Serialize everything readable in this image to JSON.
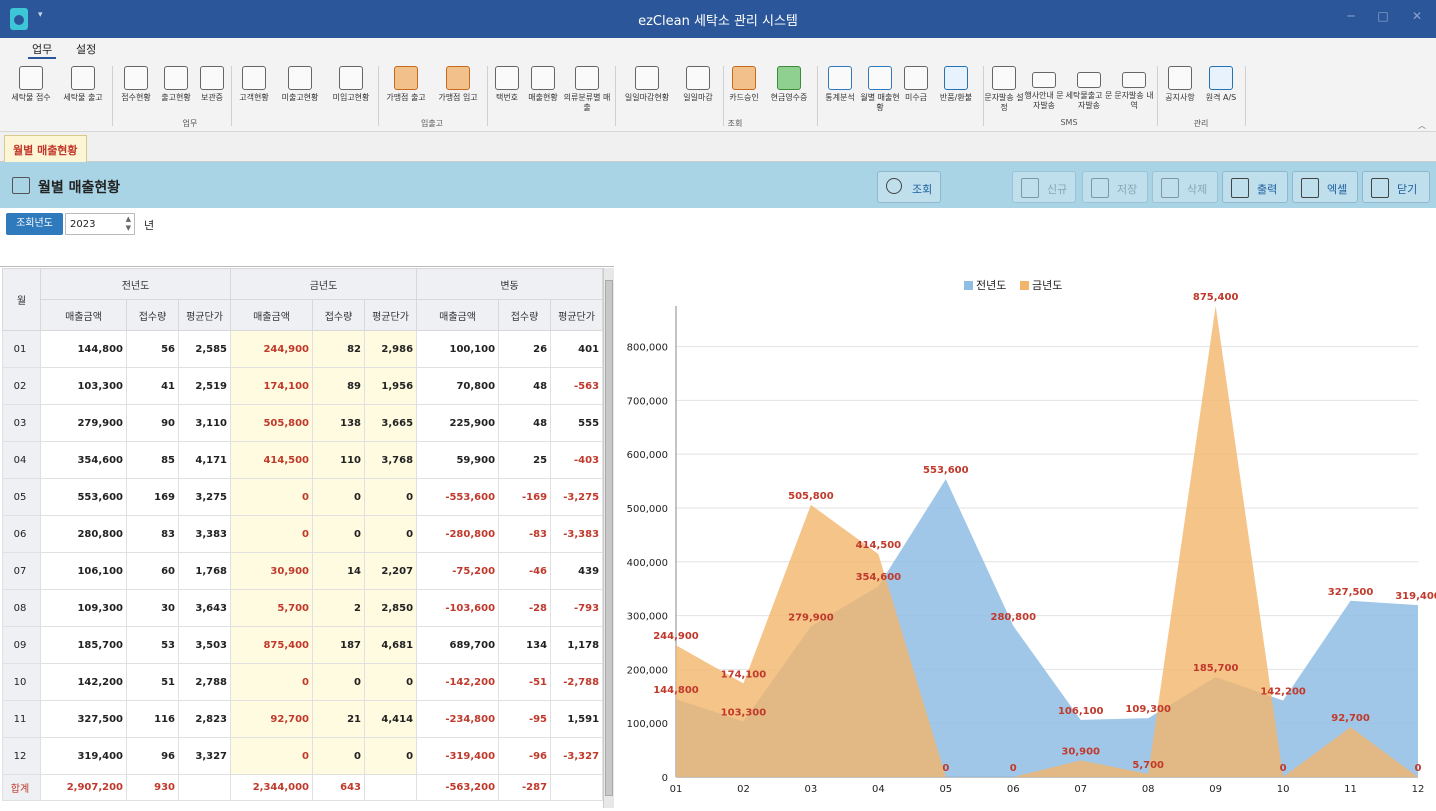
{
  "app": {
    "title": "ezClean 세탁소 관리 시스템",
    "quick_access": "▾"
  },
  "menu": {
    "tabs": [
      {
        "label": "업무",
        "active": true
      },
      {
        "label": "설정",
        "active": false
      }
    ]
  },
  "ribbon": {
    "groups": [
      {
        "label": "업무",
        "items": [
          "세탁물 접수",
          "세탁물 출고",
          "접수현황",
          "출고현황",
          "보관증",
          "고객현황",
          "미출고현황",
          "미입고현황"
        ]
      },
      {
        "label": "입출고",
        "items": [
          "가맹점 출고",
          "가맹점 입고"
        ]
      },
      {
        "label": "조회",
        "items": [
          "택번호",
          "매출현황",
          "의류분류별 매출",
          "일일마감현황",
          "일일마감",
          "카드승인",
          "현금영수증",
          "통계분석",
          "월별 매출현황",
          "미수금",
          "반품/환불"
        ]
      },
      {
        "label": "SMS",
        "items": [
          "문자발송 설정",
          "행사안내 문자발송",
          "세탁물출고 문자발송",
          "문자발송 내역"
        ]
      },
      {
        "label": "관리",
        "items": [
          "공지사항",
          "원격 A/S"
        ]
      }
    ]
  },
  "tab": {
    "label": "월별 매출현황"
  },
  "header": {
    "title": "월별 매출현황",
    "buttons": {
      "search": "조회",
      "new": "신규",
      "save": "저장",
      "delete": "삭제",
      "print": "출력",
      "excel": "엑셀",
      "close": "닫기"
    }
  },
  "filter": {
    "label": "조회년도",
    "value": "2023",
    "unit": "년"
  },
  "table": {
    "month_header": "월",
    "groups": [
      "전년도",
      "금년도",
      "변동"
    ],
    "subheaders": [
      "매출금액",
      "접수량",
      "평균단가"
    ],
    "rows": [
      [
        "01",
        "144,800",
        "56",
        "2,585",
        "244,900",
        "82",
        "2,986",
        "100,100",
        "26",
        "401"
      ],
      [
        "02",
        "103,300",
        "41",
        "2,519",
        "174,100",
        "89",
        "1,956",
        "70,800",
        "48",
        "-563"
      ],
      [
        "03",
        "279,900",
        "90",
        "3,110",
        "505,800",
        "138",
        "3,665",
        "225,900",
        "48",
        "555"
      ],
      [
        "04",
        "354,600",
        "85",
        "4,171",
        "414,500",
        "110",
        "3,768",
        "59,900",
        "25",
        "-403"
      ],
      [
        "05",
        "553,600",
        "169",
        "3,275",
        "0",
        "0",
        "0",
        "-553,600",
        "-169",
        "-3,275"
      ],
      [
        "06",
        "280,800",
        "83",
        "3,383",
        "0",
        "0",
        "0",
        "-280,800",
        "-83",
        "-3,383"
      ],
      [
        "07",
        "106,100",
        "60",
        "1,768",
        "30,900",
        "14",
        "2,207",
        "-75,200",
        "-46",
        "439"
      ],
      [
        "08",
        "109,300",
        "30",
        "3,643",
        "5,700",
        "2",
        "2,850",
        "-103,600",
        "-28",
        "-793"
      ],
      [
        "09",
        "185,700",
        "53",
        "3,503",
        "875,400",
        "187",
        "4,681",
        "689,700",
        "134",
        "1,178"
      ],
      [
        "10",
        "142,200",
        "51",
        "2,788",
        "0",
        "0",
        "0",
        "-142,200",
        "-51",
        "-2,788"
      ],
      [
        "11",
        "327,500",
        "116",
        "2,823",
        "92,700",
        "21",
        "4,414",
        "-234,800",
        "-95",
        "1,591"
      ],
      [
        "12",
        "319,400",
        "96",
        "3,327",
        "0",
        "0",
        "0",
        "-319,400",
        "-96",
        "-3,327"
      ]
    ],
    "total": [
      "합계",
      "2,907,200",
      "930",
      "",
      "2,344,000",
      "643",
      "",
      "-563,200",
      "-287",
      ""
    ]
  },
  "colors": {
    "prev": "#8fbde3",
    "cur": "#f3b56b",
    "label": "#c0392b",
    "header": "#a8d4e6",
    "accent": "#2b579a"
  },
  "chart_data": {
    "type": "area",
    "categories": [
      "01",
      "02",
      "03",
      "04",
      "05",
      "06",
      "07",
      "08",
      "09",
      "10",
      "11",
      "12"
    ],
    "series": [
      {
        "name": "전년도",
        "values": [
          144800,
          103300,
          279900,
          354600,
          553600,
          280800,
          106100,
          109300,
          185700,
          142200,
          327500,
          319400
        ]
      },
      {
        "name": "금년도",
        "values": [
          244900,
          174100,
          505800,
          414500,
          0,
          0,
          30900,
          5700,
          875400,
          0,
          92700,
          0
        ]
      }
    ],
    "yticks": [
      "0",
      "100,000",
      "200,000",
      "300,000",
      "400,000",
      "500,000",
      "600,000",
      "700,000",
      "800,000"
    ],
    "ylim": [
      0,
      875400
    ],
    "legend": "top"
  }
}
